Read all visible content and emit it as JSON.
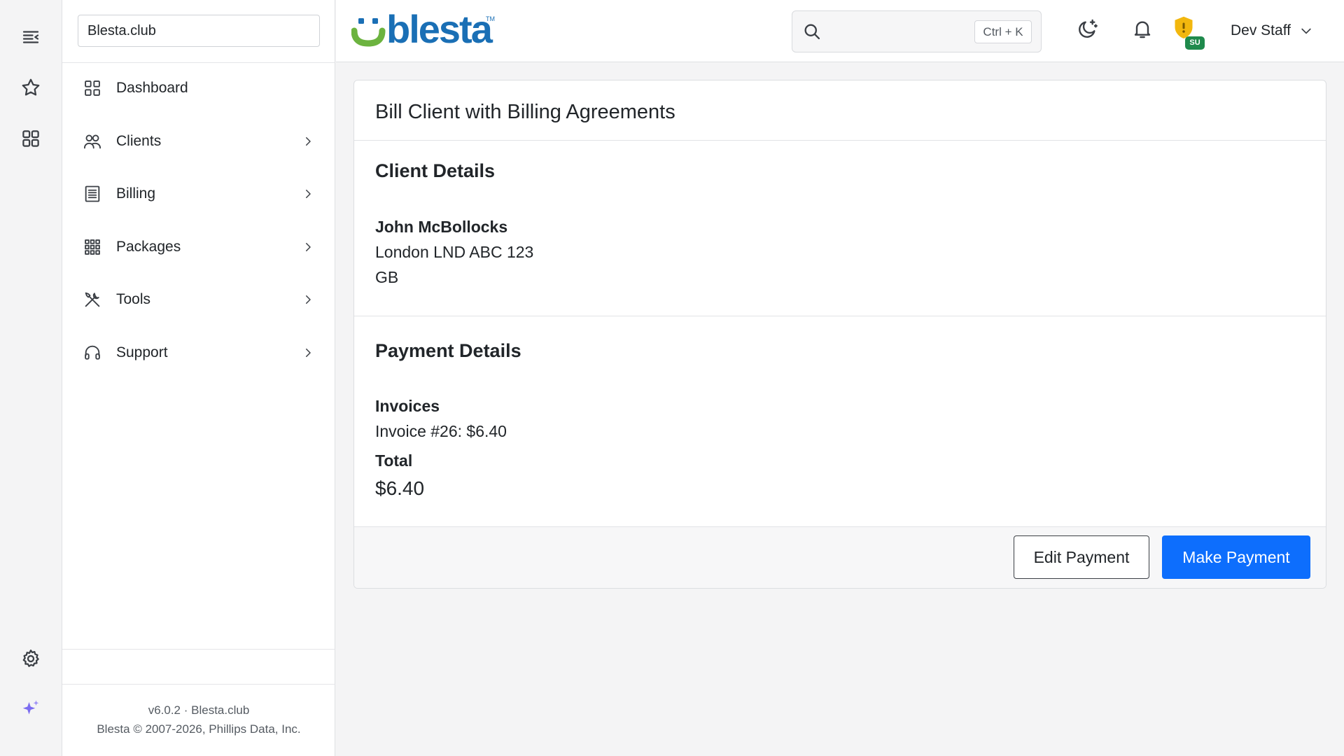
{
  "rail": {
    "icons": [
      "collapse-menu-icon",
      "star-icon",
      "apps-grid-icon",
      "gear-icon",
      "sparkle-icon"
    ]
  },
  "sidebar": {
    "company": "Blesta.club",
    "items": [
      {
        "label": "Dashboard",
        "icon": "dashboard-icon",
        "has_children": false
      },
      {
        "label": "Clients",
        "icon": "clients-icon",
        "has_children": true
      },
      {
        "label": "Billing",
        "icon": "billing-icon",
        "has_children": true
      },
      {
        "label": "Packages",
        "icon": "packages-icon",
        "has_children": true
      },
      {
        "label": "Tools",
        "icon": "tools-icon",
        "has_children": true
      },
      {
        "label": "Support",
        "icon": "headset-icon",
        "has_children": true
      }
    ],
    "footer": {
      "version": "v6.0.2 · Blesta.club",
      "copyright": "Blesta © 2007-2026, Phillips Data, Inc."
    }
  },
  "header": {
    "logo_text": "blesta",
    "logo_tm": "TM",
    "search": {
      "placeholder": "",
      "shortcut": "Ctrl + K"
    },
    "su_badge": "SU",
    "user_name": "Dev Staff"
  },
  "card": {
    "title": "Bill Client with Billing Agreements",
    "client_details": {
      "heading": "Client Details",
      "name": "John McBollocks",
      "address_line": "London LND ABC 123",
      "country": "GB"
    },
    "payment_details": {
      "heading": "Payment Details",
      "invoices_label": "Invoices",
      "invoice_line": "Invoice #26: $6.40",
      "total_label": "Total",
      "total_amount": "$6.40"
    },
    "buttons": {
      "edit": "Edit Payment",
      "make": "Make Payment"
    }
  },
  "colors": {
    "primary": "#0d6efd",
    "logo_blue": "#1a6fb5",
    "logo_green": "#6cb33f",
    "shield_yellow": "#f2b70e",
    "su_green": "#1f8a4c"
  }
}
